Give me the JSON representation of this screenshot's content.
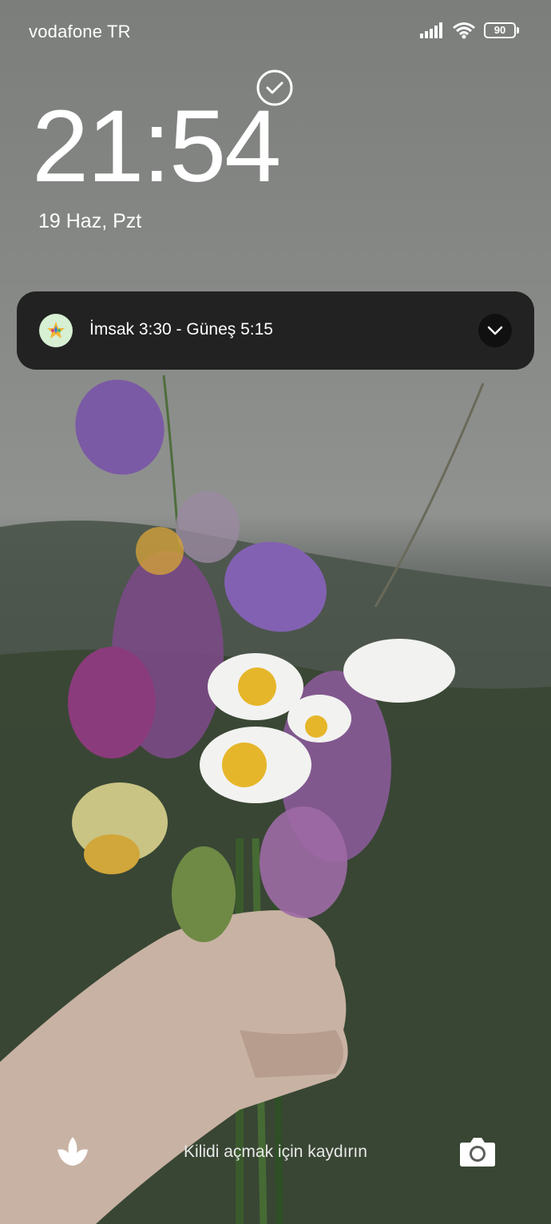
{
  "status_bar": {
    "carrier": "vodafone TR",
    "battery_level": "90",
    "icons": [
      "signal-icon",
      "wifi-icon",
      "battery-icon"
    ]
  },
  "lock_screen": {
    "time": "21:54",
    "date": "19 Haz, Pzt",
    "unlock_hint": "Kilidi açmak için kaydırın"
  },
  "notification": {
    "app_icon": "app-star-icon",
    "text": "İmsak 3:30 - Güneş 5:15",
    "expand_icon": "chevron-down-icon"
  },
  "shortcuts": {
    "left": "flower-icon",
    "right": "camera-icon"
  },
  "colors": {
    "notification_bg": "#1e1e1e",
    "text": "#ffffff"
  }
}
